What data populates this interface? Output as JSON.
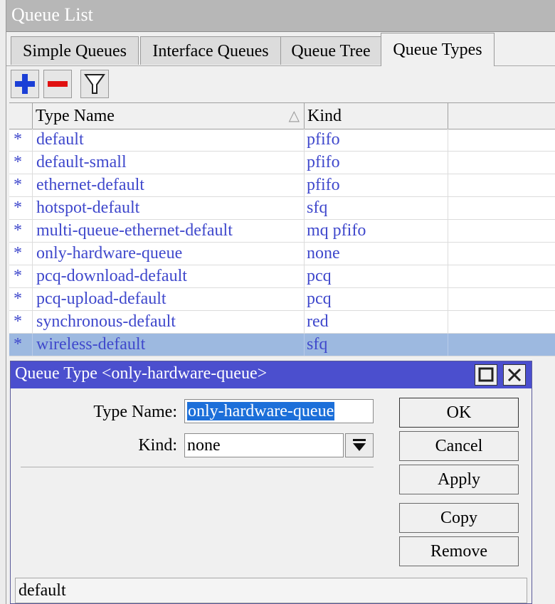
{
  "window": {
    "title": "Queue List"
  },
  "tabs": [
    {
      "label": "Simple Queues",
      "active": false
    },
    {
      "label": "Interface Queues",
      "active": false
    },
    {
      "label": "Queue Tree",
      "active": false
    },
    {
      "label": "Queue Types",
      "active": true
    }
  ],
  "toolbar": {
    "icons": [
      "add-icon",
      "remove-icon",
      "filter-icon"
    ]
  },
  "table": {
    "columns": [
      "",
      "Type Name",
      "Kind"
    ],
    "sort_indicator": "△",
    "rows": [
      {
        "marker": "*",
        "name": "default",
        "kind": "pfifo"
      },
      {
        "marker": "*",
        "name": "default-small",
        "kind": "pfifo"
      },
      {
        "marker": "*",
        "name": "ethernet-default",
        "kind": "pfifo"
      },
      {
        "marker": "*",
        "name": "hotspot-default",
        "kind": "sfq"
      },
      {
        "marker": "*",
        "name": "multi-queue-ethernet-default",
        "kind": "mq pfifo"
      },
      {
        "marker": "*",
        "name": "only-hardware-queue",
        "kind": "none"
      },
      {
        "marker": "*",
        "name": "pcq-download-default",
        "kind": "pcq"
      },
      {
        "marker": "*",
        "name": "pcq-upload-default",
        "kind": "pcq"
      },
      {
        "marker": "*",
        "name": "synchronous-default",
        "kind": "red"
      },
      {
        "marker": "*",
        "name": "wireless-default",
        "kind": "sfq"
      }
    ],
    "selected_row": "wireless-default"
  },
  "dialog": {
    "title": "Queue Type <only-hardware-queue>",
    "type_name_label": "Type Name:",
    "type_name_value": "only-hardware-queue",
    "kind_label": "Kind:",
    "kind_value": "none",
    "buttons": {
      "ok": "OK",
      "cancel": "Cancel",
      "apply": "Apply",
      "copy": "Copy",
      "remove": "Remove"
    },
    "status": "default"
  },
  "colors": {
    "accent": "#4b4fce",
    "link_text": "#3f48cc",
    "selection": "#9db9e0"
  }
}
